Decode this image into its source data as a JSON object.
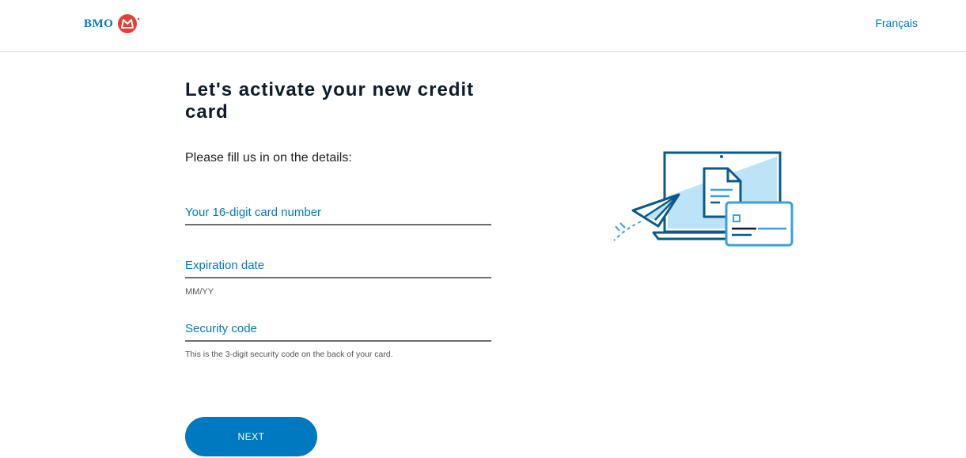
{
  "header": {
    "logo_text": "BMO",
    "language_link": "Français"
  },
  "main": {
    "title": "Let's activate your new credit card",
    "intro": "Please fill us in on the details:",
    "fields": {
      "card_number": {
        "label": "Your 16-digit card number"
      },
      "expiration": {
        "label": "Expiration date",
        "hint": "MM/YY"
      },
      "security": {
        "label": "Security code",
        "hint": "This is the 3-digit security code on the back of your card."
      }
    },
    "next_button": "NEXT"
  },
  "colors": {
    "brand_blue": "#0079c1",
    "logo_red": "#e1403a",
    "illustration_light": "#bde3f7"
  },
  "icons": {
    "logo": "bmo-roundel-icon",
    "illustration": "laptop-card-paper-plane-illustration"
  }
}
